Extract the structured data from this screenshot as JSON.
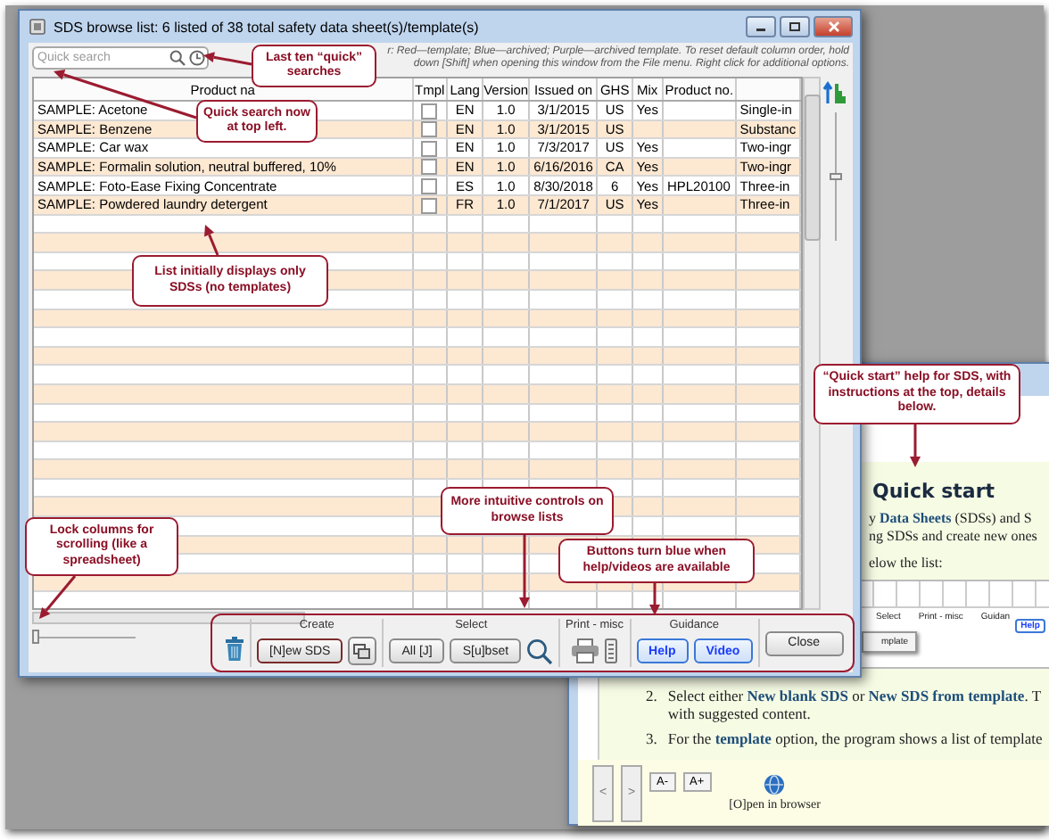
{
  "main_window": {
    "title": "SDS browse list: 6 listed of 38 total safety data sheet(s)/template(s)",
    "search": {
      "placeholder": "Quick search"
    },
    "legend": [
      "r: Red—template; Blue—archived; Purple—archived template. To reset default column order, hold",
      "down [Shift] when opening this window from the File menu. Right click for additional options."
    ],
    "table": {
      "columns": [
        "Product na",
        "Tmpl",
        "Lang",
        "Version",
        "Issued on",
        "GHS",
        "Mix",
        "Product no."
      ],
      "rows": [
        {
          "product": "SAMPLE: Acetone",
          "tmpl": false,
          "lang": "EN",
          "version": "1.0",
          "issued": "3/1/2015",
          "ghs": "US",
          "mix": "Yes",
          "column_9": "Single-in"
        },
        {
          "product": "SAMPLE: Benzene",
          "tmpl": false,
          "lang": "EN",
          "version": "1.0",
          "issued": "3/1/2015",
          "ghs": "US",
          "column_9": "Substanc"
        },
        {
          "product": "SAMPLE: Car wax",
          "tmpl": false,
          "lang": "EN",
          "version": "1.0",
          "issued": "7/3/2017",
          "ghs": "US",
          "mix": "Yes",
          "column_9": "Two-ingr"
        },
        {
          "product": "SAMPLE: Formalin solution, neutral buffered, 10%",
          "tmpl": false,
          "lang": "EN",
          "version": "1.0",
          "issued": "6/16/2016",
          "ghs": "CA",
          "mix": "Yes",
          "column_9": "Two-ingr"
        },
        {
          "product": "SAMPLE: Foto-Ease Fixing Concentrate",
          "tmpl": false,
          "lang": "ES",
          "version": "1.0",
          "issued": "8/30/2018",
          "ghs": "6",
          "mix": "Yes",
          "product_no": "HPL20100",
          "column_9": "Three-in"
        },
        {
          "product": "SAMPLE: Powdered laundry detergent",
          "tmpl": false,
          "lang": "FR",
          "version": "1.0",
          "issued": "7/1/2017",
          "ghs": "US",
          "mix": "Yes",
          "column_9": "Three-in"
        }
      ]
    },
    "side_slider": {
      "level": 0.5
    },
    "lock_slider": {
      "level": 0
    },
    "toolbar": {
      "create_label": "Create",
      "new_button": "[N]ew SDS",
      "select_label": "Select",
      "all_button": "All [J]",
      "subset_button": "S[u]bset",
      "print_label": "Print - misc",
      "guidance_label": "Guidance",
      "help_button": {
        "label": "Help",
        "available": true
      },
      "video_button": {
        "label": "Video",
        "available": true
      },
      "close_button": "Close"
    }
  },
  "help_window": {
    "heading": "Quick start",
    "intro_lines": [
      "y **Data Sheets** (SDSs) and S",
      "ng SDSs and create new ones",
      "elow the list:"
    ],
    "mini_screenshot": {
      "labels": [
        "Select",
        "Print - misc",
        "Guidan"
      ],
      "help_button": "Help",
      "popup": "mplate"
    },
    "steps": [
      {
        "number": "2.",
        "lines": [
          "Select either **New blank SDS** or **New SDS from template**. T",
          "with suggested content."
        ]
      },
      {
        "number": "3.",
        "lines": [
          "For the **template** option, the program shows a list of template"
        ]
      }
    ],
    "nav_buttons": [
      "<",
      ">"
    ],
    "font_buttons": [
      "A-",
      "A+"
    ],
    "open_label": "[O]pen in browser"
  },
  "callouts": [
    "Last ten “quick” searches",
    "Quick search now at top left.",
    "List initially displays only SDSs (no templates)",
    "Lock columns for scrolling (like a spreadsheet)",
    "More intuitive controls on browse lists",
    "Buttons turn blue when help/videos are available",
    "“Quick start” help for SDS, with instructions at the top, details below."
  ]
}
